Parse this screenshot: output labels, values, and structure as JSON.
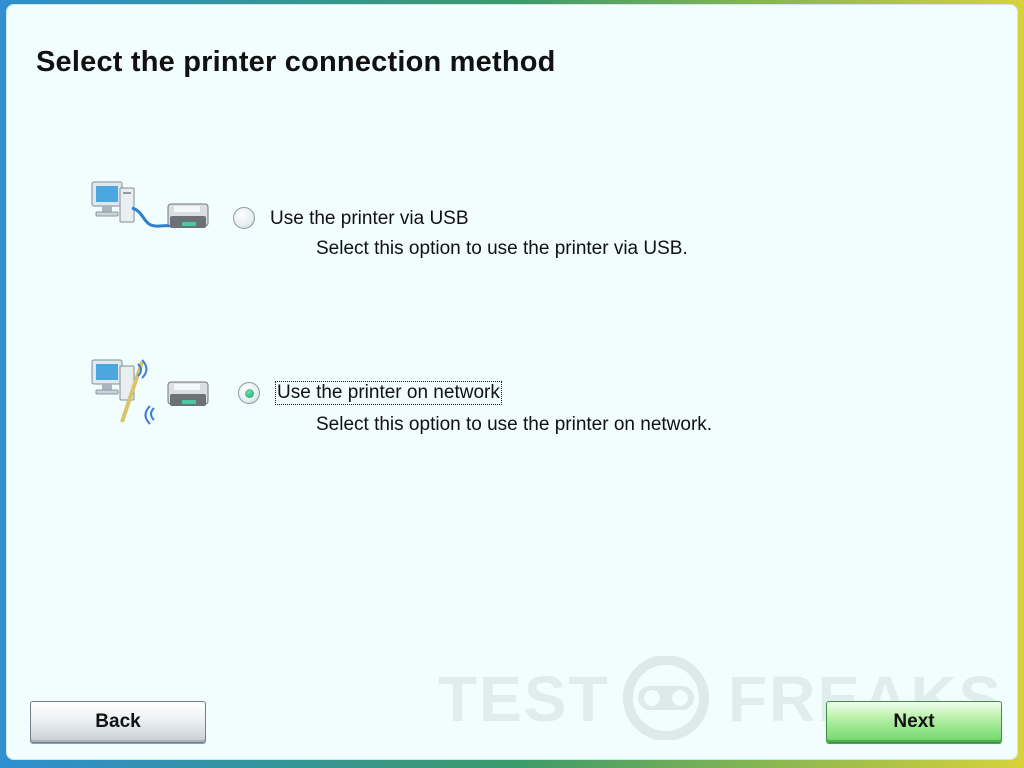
{
  "dialog": {
    "title": "Select the printer connection method"
  },
  "options": [
    {
      "id": "usb",
      "label": "Use the printer via USB",
      "description": "Select this option to use the printer via USB.",
      "selected": false,
      "icon": "computer-usb-printer-icon"
    },
    {
      "id": "network",
      "label": "Use the printer on network",
      "description": "Select this option to use the printer on network.",
      "selected": true,
      "icon": "computer-network-printer-icon"
    }
  ],
  "buttons": {
    "back_label": "Back",
    "next_label": "Next"
  },
  "watermark": {
    "left_text": "TEST",
    "right_text": "FREAKS"
  },
  "colors": {
    "panel_background": "#f2fdfd",
    "radio_selected": "#1f9a6a",
    "next_button": "#6fd86a",
    "back_button": "#c7ced3"
  }
}
